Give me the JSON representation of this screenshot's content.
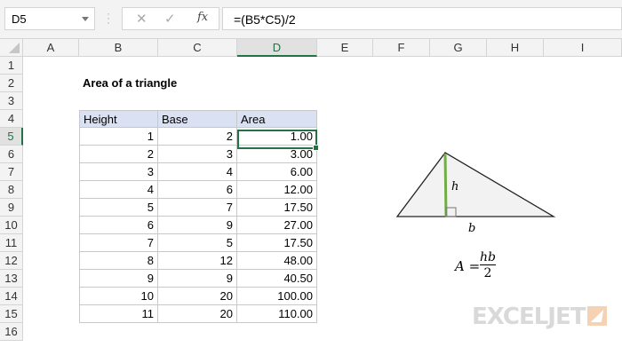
{
  "name_box": "D5",
  "formula": "=(B5*C5)/2",
  "icons": {
    "cancel": "✕",
    "enter": "✓",
    "fx": "fx"
  },
  "columns": [
    "A",
    "B",
    "C",
    "D",
    "E",
    "F",
    "G",
    "H",
    "I"
  ],
  "rows": [
    "1",
    "2",
    "3",
    "4",
    "5",
    "6",
    "7",
    "8",
    "9",
    "10",
    "11",
    "12",
    "13",
    "14",
    "15",
    "16"
  ],
  "title": "Area of a triangle",
  "table": {
    "headers": [
      "Height",
      "Base",
      "Area"
    ],
    "rows": [
      [
        "1",
        "2",
        "1.00"
      ],
      [
        "2",
        "3",
        "3.00"
      ],
      [
        "3",
        "4",
        "6.00"
      ],
      [
        "4",
        "6",
        "12.00"
      ],
      [
        "5",
        "7",
        "17.50"
      ],
      [
        "6",
        "9",
        "27.00"
      ],
      [
        "7",
        "5",
        "17.50"
      ],
      [
        "8",
        "12",
        "48.00"
      ],
      [
        "9",
        "9",
        "40.50"
      ],
      [
        "10",
        "20",
        "100.00"
      ],
      [
        "11",
        "20",
        "110.00"
      ]
    ]
  },
  "diagram": {
    "h_label": "h",
    "b_label": "b",
    "formula_lhs": "A =",
    "formula_num": "hb",
    "formula_den": "2",
    "height_color": "#70ad47"
  },
  "logo": "EXCELJET"
}
